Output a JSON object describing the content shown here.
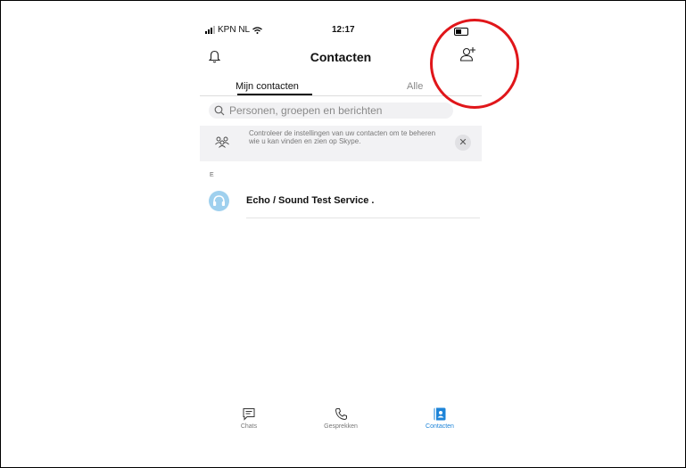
{
  "status": {
    "carrier": "KPN NL",
    "time": "12:17"
  },
  "header": {
    "title": "Contacten",
    "bell_icon": "bell-icon",
    "add_icon": "add-contact-icon"
  },
  "tabs": [
    {
      "label": "Mijn contacten",
      "active": true
    },
    {
      "label": "Alle",
      "active": false
    }
  ],
  "search": {
    "placeholder": "Personen, groepen en berichten",
    "icon": "search-icon"
  },
  "notice": {
    "text": "Controleer de instellingen van uw contacten om te beheren wie u kan vinden en zien op Skype.",
    "close_glyph": "✕",
    "icon": "people-icon"
  },
  "section": {
    "letter": "E"
  },
  "contacts": [
    {
      "name": "Echo / Sound Test Service .",
      "avatar_color": "#9fd0ee"
    }
  ],
  "bottom_nav": [
    {
      "label": "Chats",
      "icon": "chat-icon",
      "active": false
    },
    {
      "label": "Gesprekken",
      "icon": "phone-icon",
      "active": false
    },
    {
      "label": "Contacten",
      "icon": "contacts-icon",
      "active": true
    }
  ],
  "colors": {
    "accent": "#1e84d8",
    "annotation": "#e0161a"
  }
}
